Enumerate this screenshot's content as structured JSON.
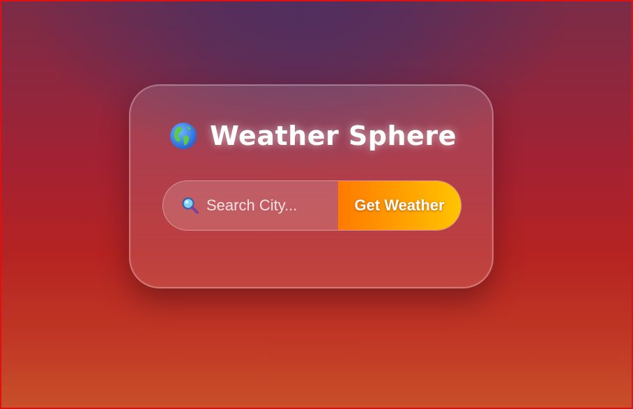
{
  "app": {
    "title": "Weather Sphere",
    "logo_icon": "globe-americas-icon"
  },
  "search": {
    "icon": "magnifying-glass-icon",
    "placeholder": "Search City...",
    "value": "",
    "button_label": "Get Weather"
  },
  "colors": {
    "background_top": "#4f2f5f",
    "background_mid": "#b52322",
    "background_bottom": "#c8502a",
    "button_gradient_start": "#ff7a00",
    "button_gradient_end": "#ffc400",
    "text": "#ffffff",
    "frame_border": "#e01010"
  }
}
